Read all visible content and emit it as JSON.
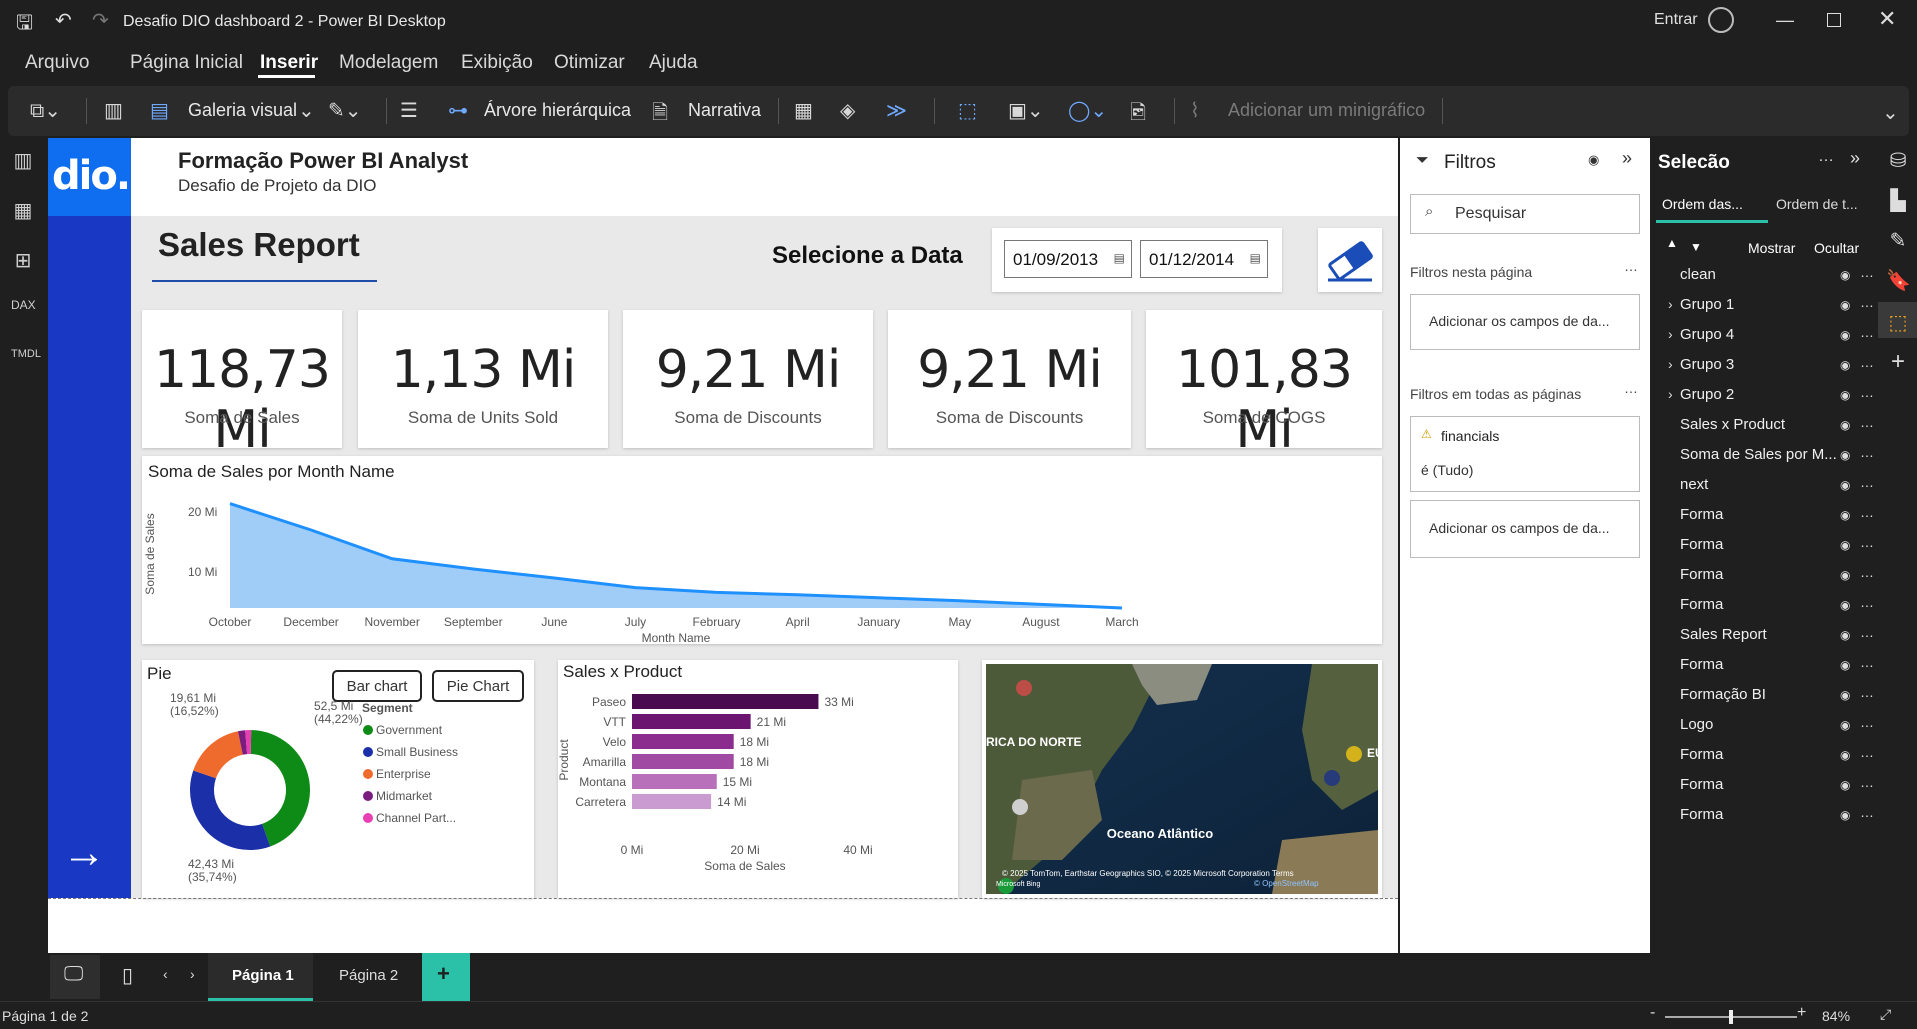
{
  "window": {
    "title": "Desafio DIO dashboard 2 - Power BI Desktop",
    "signin": "Entrar"
  },
  "menu": [
    "Arquivo",
    "Página Inicial",
    "Inserir",
    "Modelagem",
    "Exibição",
    "Otimizar",
    "Ajuda"
  ],
  "menu_active": "Inserir",
  "ribbon": {
    "visual_gallery": "Galeria visual",
    "tree": "Árvore hierárquica",
    "narrative": "Narrativa",
    "sparkline": "Adicionar um minigráfico"
  },
  "report": {
    "title": "Formação Power BI Analyst",
    "subtitle": "Desafio de Projeto da DIO",
    "logo_text": "dio.",
    "section_title": "Sales Report",
    "date_prompt": "Selecione a Data",
    "date_start": "01/09/2013",
    "date_end": "01/12/2014"
  },
  "kpis": [
    {
      "value": "118,73 Mi",
      "label": "Soma de  Sales"
    },
    {
      "value": "1,13 Mi",
      "label": "Soma de Units Sold"
    },
    {
      "value": "9,21 Mi",
      "label": "Soma de Discounts"
    },
    {
      "value": "9,21 Mi",
      "label": "Soma de Discounts"
    },
    {
      "value": "101,83 Mi",
      "label": "Soma de COGS"
    }
  ],
  "chart_data": [
    {
      "type": "area",
      "title": "Soma de Sales por Month Name",
      "xlabel": "Month Name",
      "ylabel": "Soma de Sales",
      "categories": [
        "October",
        "December",
        "November",
        "September",
        "June",
        "July",
        "February",
        "April",
        "January",
        "May",
        "August",
        "March"
      ],
      "values": [
        21.4,
        17.0,
        12.2,
        10.5,
        9.0,
        7.4,
        6.6,
        6.2,
        5.7,
        5.2,
        4.6,
        4.0
      ],
      "yticks": [
        "10 Mi",
        "20 Mi"
      ],
      "ylim": [
        4,
        22
      ],
      "color": "#1e90ff"
    },
    {
      "type": "pie",
      "title": "Pie",
      "legend_title": "Segment",
      "labels": [
        "Government",
        "Small Business",
        "Enterprise",
        "Midmarket",
        "Channel Part..."
      ],
      "values": [
        52.5,
        42.43,
        19.61,
        2.3,
        1.9
      ],
      "colors": [
        "#0e8a16",
        "#1a2fa8",
        "#ef6a2d",
        "#7b1c7f",
        "#e83fb4"
      ],
      "data_labels": [
        {
          "line1": "52,5 Mi",
          "line2": "(44,22%)"
        },
        {
          "line1": "42,43 Mi",
          "line2": "(35,74%)"
        },
        {
          "line1": "19,61 Mi",
          "line2": "(16,52%)"
        }
      ]
    },
    {
      "type": "bar",
      "title": "Sales x Product",
      "xlabel": "Soma de Sales",
      "ylabel": "Product",
      "categories": [
        "Paseo",
        "VTT",
        "Velo",
        "Amarilla",
        "Montana",
        "Carretera"
      ],
      "values": [
        33,
        21,
        18,
        18,
        15,
        14
      ],
      "value_labels": [
        "33 Mi",
        "21 Mi",
        "18 Mi",
        "18 Mi",
        "15 Mi",
        "14 Mi"
      ],
      "xticks": [
        "0 Mi",
        "20 Mi",
        "40 Mi"
      ],
      "xlim": [
        0,
        40
      ],
      "colors": [
        "#4a0a4f",
        "#6b1470",
        "#8b2c8f",
        "#a04aa4",
        "#b870bb",
        "#c99bd0"
      ]
    }
  ],
  "pie_buttons": {
    "bar": "Bar chart",
    "pie": "Pie Chart"
  },
  "map": {
    "label_na": "RICA DO NORTE",
    "label_ocean": "Oceano Atlântico",
    "label_eu": "EU",
    "attribution": "© 2025 TomTom, Earthstar Geographics SIO, © 2025 Microsoft Corporation  Terms",
    "osm": "© OpenStreetMap",
    "brand": "Microsoft Bing"
  },
  "filters": {
    "title": "Filtros",
    "search_placeholder": "Pesquisar",
    "on_page": "Filtros nesta página",
    "add_fields_1": "Adicionar os campos de da...",
    "all_pages": "Filtros em todas as páginas",
    "field_name": "financials",
    "field_value": "é (Tudo)",
    "add_fields_2": "Adicionar os campos de da..."
  },
  "selection": {
    "title": "Selecão",
    "tab1": "Ordem das...",
    "tab2": "Ordem de t...",
    "show": "Mostrar",
    "hide": "Ocultar",
    "items": [
      {
        "label": "clean",
        "group": false
      },
      {
        "label": "Grupo 1",
        "group": true
      },
      {
        "label": "Grupo 4",
        "group": true
      },
      {
        "label": "Grupo 3",
        "group": true
      },
      {
        "label": "Grupo 2",
        "group": true
      },
      {
        "label": "Sales x Product",
        "group": false
      },
      {
        "label": "Soma de Sales por M...",
        "group": false
      },
      {
        "label": "next",
        "group": false
      },
      {
        "label": "Forma",
        "group": false
      },
      {
        "label": "Forma",
        "group": false
      },
      {
        "label": "Forma",
        "group": false
      },
      {
        "label": "Forma",
        "group": false
      },
      {
        "label": "Sales Report",
        "group": false
      },
      {
        "label": "Forma",
        "group": false
      },
      {
        "label": "Formação BI",
        "group": false
      },
      {
        "label": "Logo",
        "group": false
      },
      {
        "label": "Forma",
        "group": false
      },
      {
        "label": "Forma",
        "group": false
      },
      {
        "label": "Forma",
        "group": false
      }
    ]
  },
  "pages": {
    "tab1": "Página 1",
    "tab2": "Página 2",
    "add": "+"
  },
  "status": {
    "page_info": "Página 1 de 2",
    "zoom": "84%",
    "zoom_fraction": 0.5
  }
}
